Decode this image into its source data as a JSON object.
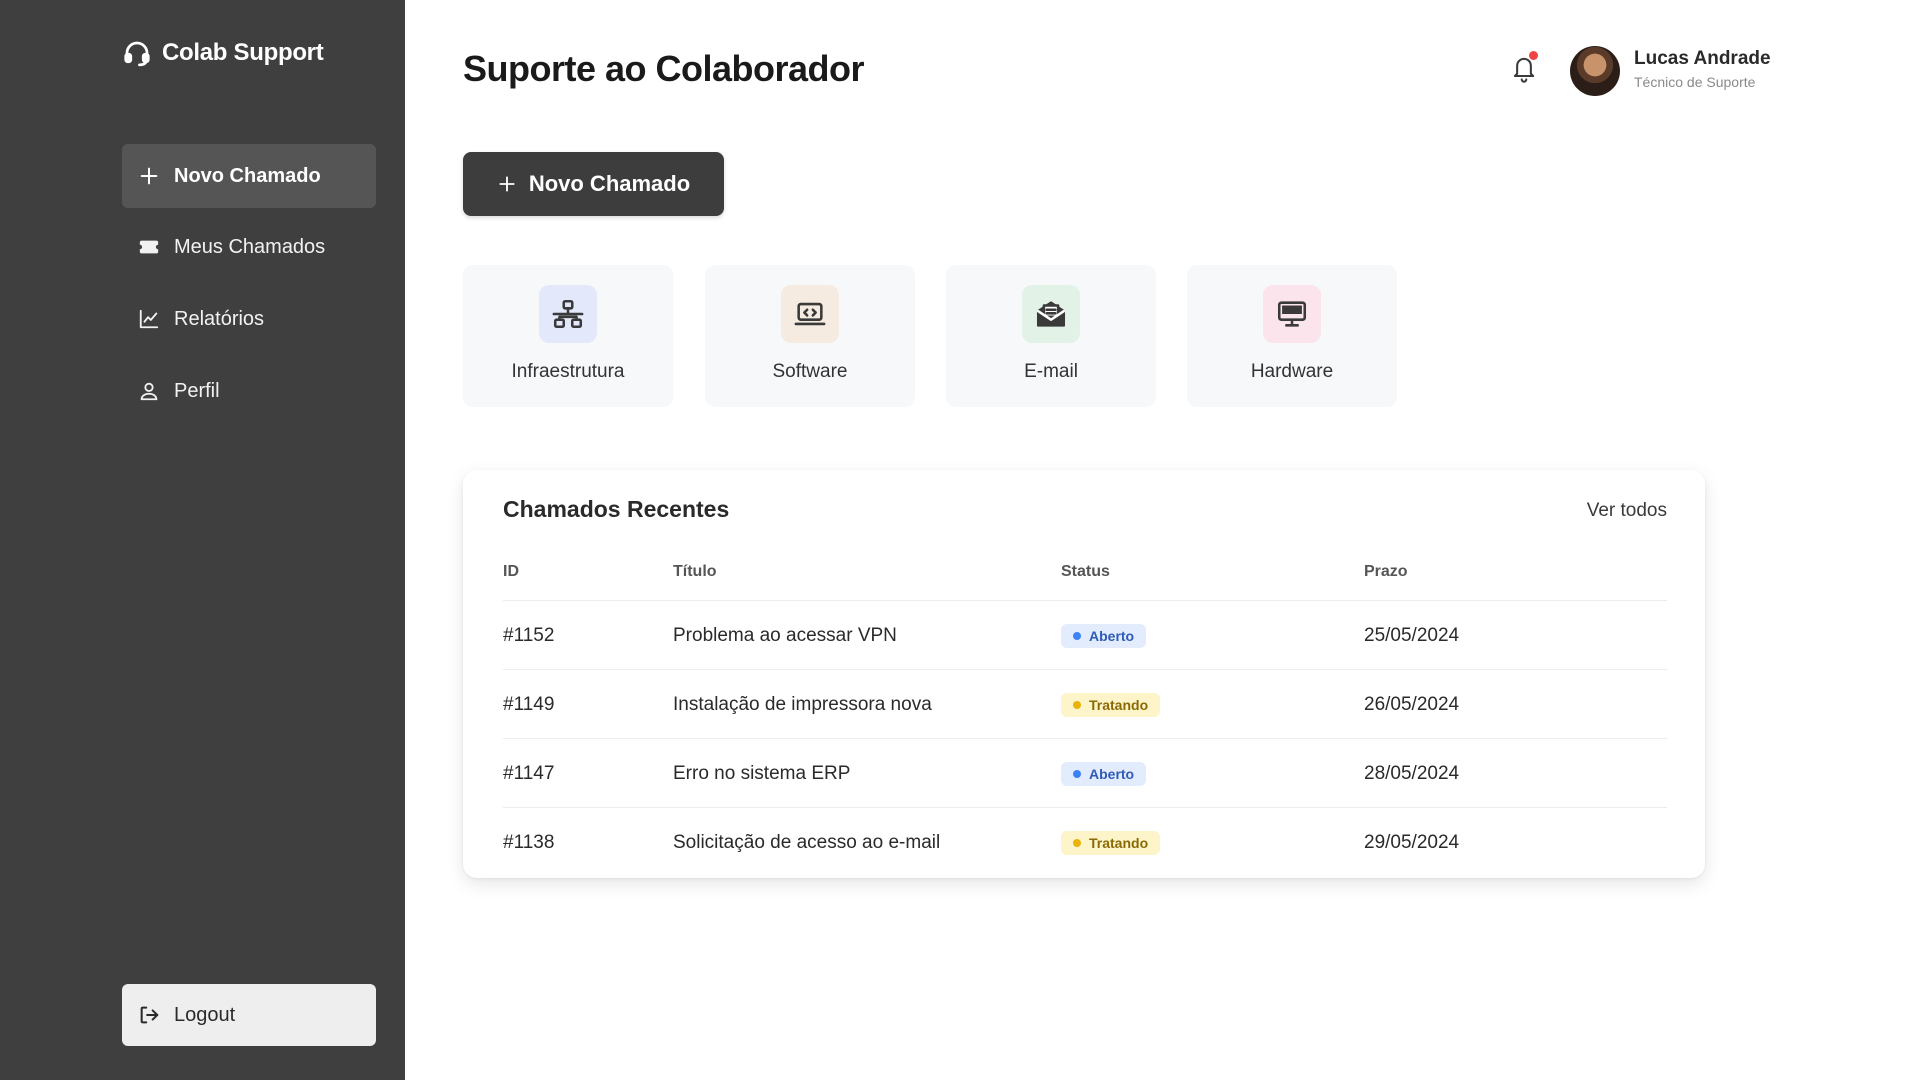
{
  "app": {
    "brand": "Colab Support",
    "page_title": "Suporte ao Colaborador"
  },
  "sidebar": {
    "items": [
      {
        "label": "Novo Chamado",
        "icon": "plus-icon",
        "active": true
      },
      {
        "label": "Meus Chamados",
        "icon": "ticket-icon",
        "active": false
      },
      {
        "label": "Relatórios",
        "icon": "chart-line-icon",
        "active": false
      },
      {
        "label": "Perfil",
        "icon": "user-icon",
        "active": false
      }
    ],
    "logout_label": "Logout"
  },
  "header": {
    "user_name": "Lucas Andrade",
    "user_role": "Técnico de Suporte",
    "has_notification": true
  },
  "new_ticket_button": "Novo Chamado",
  "categories": [
    {
      "label": "Infraestrutura",
      "icon": "network-icon",
      "color": "#e3e8fb"
    },
    {
      "label": "Software",
      "icon": "code-laptop-icon",
      "color": "#f5ebe0"
    },
    {
      "label": "E-mail",
      "icon": "mail-open-icon",
      "color": "#e2f2e7"
    },
    {
      "label": "Hardware",
      "icon": "monitor-icon",
      "color": "#fbe4ec"
    }
  ],
  "recent": {
    "title": "Chamados Recentes",
    "see_all": "Ver todos",
    "columns": [
      "ID",
      "Título",
      "Status",
      "Prazo"
    ],
    "rows": [
      {
        "id": "#1152",
        "title": "Problema ao acessar VPN",
        "status": "Aberto",
        "date": "25/05/2024"
      },
      {
        "id": "#1149",
        "title": "Instalação de impressora nova",
        "status": "Tratando",
        "date": "26/05/2024"
      },
      {
        "id": "#1147",
        "title": "Erro no sistema ERP",
        "status": "Aberto",
        "date": "28/05/2024"
      },
      {
        "id": "#1138",
        "title": "Solicitação de acesso ao e-mail",
        "status": "Tratando",
        "date": "29/05/2024"
      }
    ]
  }
}
